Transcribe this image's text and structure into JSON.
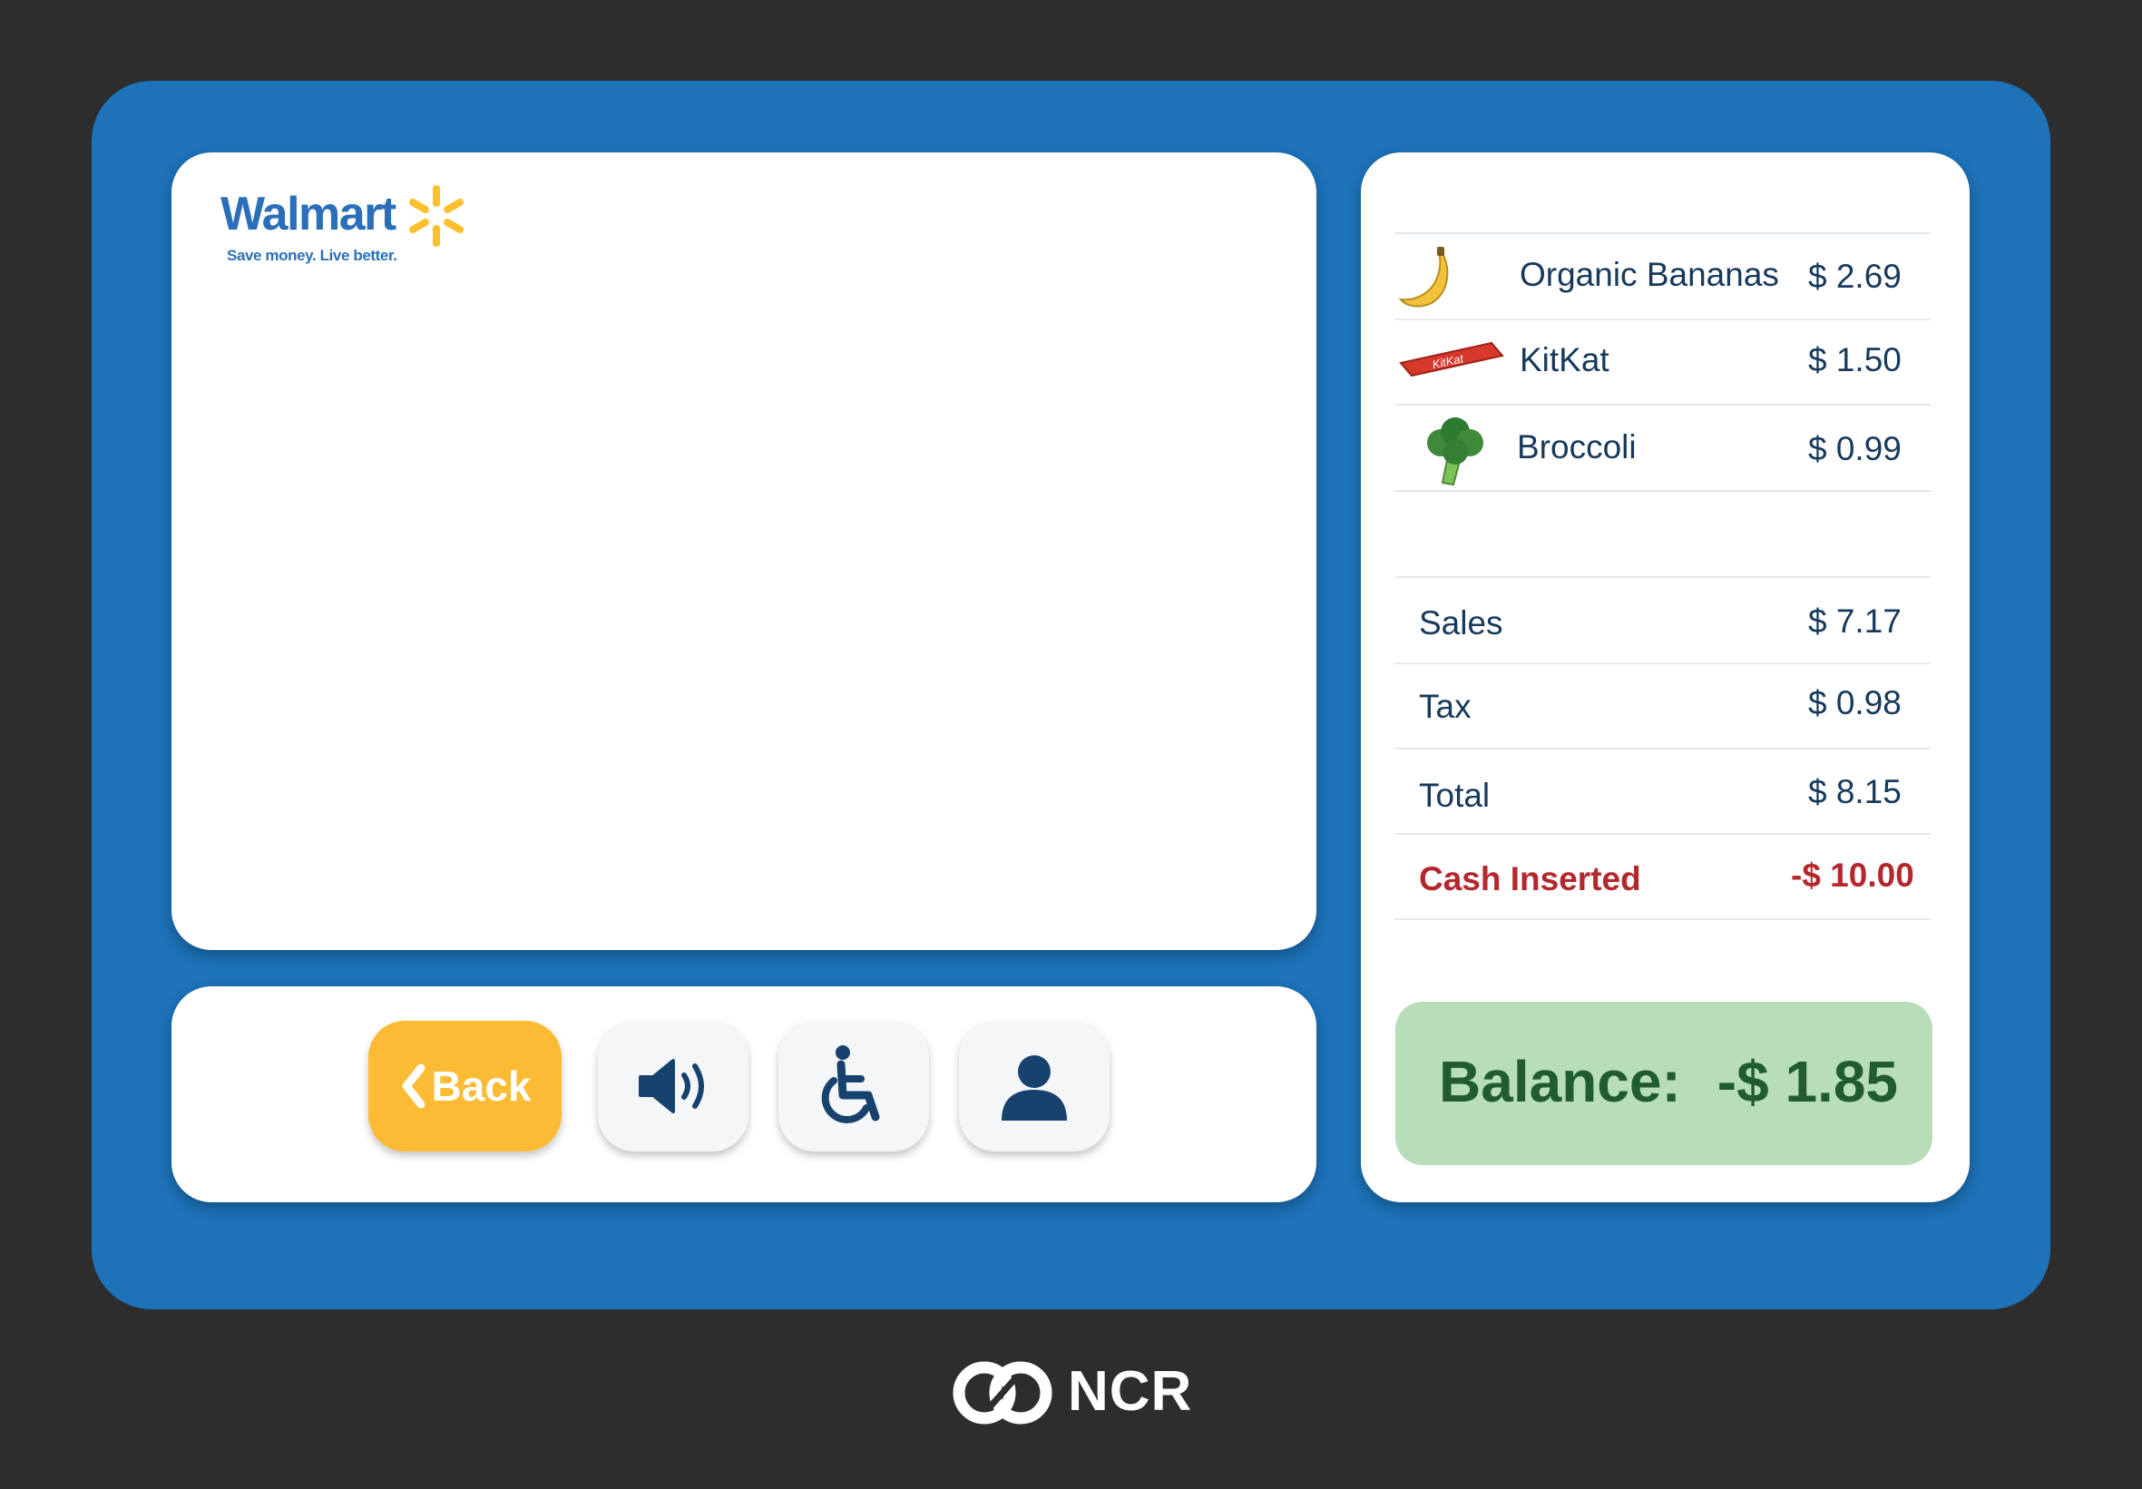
{
  "logo": {
    "name": "Walmart",
    "tagline": "Save money. Live better."
  },
  "controls": {
    "back_label": "Back",
    "sound_icon": "speaker-volume-icon",
    "accessibility_icon": "wheelchair-icon",
    "user_icon": "person-icon"
  },
  "items": [
    {
      "name": "Organic Bananas",
      "price": "$ 2.69",
      "icon": "banana-icon"
    },
    {
      "name": "KitKat",
      "price": "$ 1.50",
      "icon": "kitkat-icon"
    },
    {
      "name": "Broccoli",
      "price": "$ 0.99",
      "icon": "broccoli-icon"
    }
  ],
  "summary": {
    "sales_label": "Sales",
    "sales_value": "$ 7.17",
    "tax_label": "Tax",
    "tax_value": "$ 0.98",
    "total_label": "Total",
    "total_value": "$ 8.15",
    "cash_label": "Cash Inserted",
    "cash_value": "-$ 10.00"
  },
  "balance": {
    "label": "Balance:",
    "value": "-$ 1.85"
  },
  "brand": {
    "name": "NCR"
  },
  "colors": {
    "background": "#2d2d2d",
    "kiosk": "#1d72b8",
    "back_button": "#fbbb35",
    "text": "#17395c",
    "cash": "#b3282d",
    "balance_bg": "#b7ddb9",
    "balance_text": "#215c2f"
  }
}
